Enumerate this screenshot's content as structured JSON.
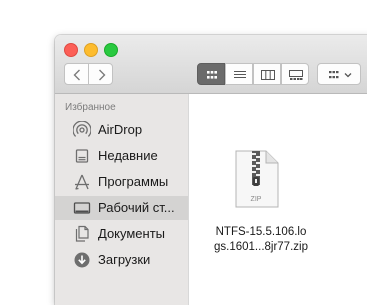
{
  "sidebar": {
    "section_title": "Избранное",
    "items": [
      {
        "label": "AirDrop",
        "icon": "airdrop-icon"
      },
      {
        "label": "Недавние",
        "icon": "recents-icon"
      },
      {
        "label": "Программы",
        "icon": "applications-icon"
      },
      {
        "label": "Рабочий ст...",
        "icon": "desktop-icon",
        "selected": true
      },
      {
        "label": "Документы",
        "icon": "documents-icon"
      },
      {
        "label": "Загрузки",
        "icon": "downloads-icon"
      }
    ]
  },
  "file": {
    "name_line1": "NTFS-15.5.106.lo",
    "name_line2": "gs.1601...8jr77.zip",
    "badge": "ZIP",
    "icon": "zip-archive-icon"
  }
}
